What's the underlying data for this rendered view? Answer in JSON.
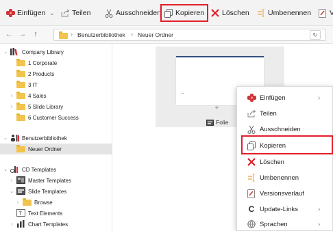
{
  "toolbar": {
    "paste_label": "Einfügen",
    "share_label": "Teilen",
    "cut_label": "Ausschneiden",
    "copy_label": "Kopieren",
    "delete_label": "Löschen",
    "rename_label": "Umbenennen",
    "versions_label": "Ve",
    "highlight_color": "#e31c2b"
  },
  "breadcrumb": {
    "items": [
      "Benutzerbibliothek",
      "Neuer Ordner"
    ]
  },
  "sidebar": {
    "items": [
      {
        "label": "Company Library",
        "icon": "library-icon"
      },
      {
        "label": "1 Corporate",
        "icon": "folder-icon"
      },
      {
        "label": "2 Products",
        "icon": "folder-icon"
      },
      {
        "label": "3 IT",
        "icon": "folder-icon"
      },
      {
        "label": "4 Sales",
        "icon": "folder-icon"
      },
      {
        "label": "5 Slide Library",
        "icon": "folder-icon"
      },
      {
        "label": "6 Customer Success",
        "icon": "folder-icon"
      },
      {
        "label": "Benutzerbibliothek",
        "icon": "user-library-icon"
      },
      {
        "label": "Neuer Ordner",
        "icon": "folder-icon",
        "selected": true
      },
      {
        "label": "CD Templates",
        "icon": "templates-icon"
      },
      {
        "label": "Master Templates",
        "icon": "master-template-icon"
      },
      {
        "label": "Slide Templates",
        "icon": "slide-template-icon"
      },
      {
        "label": "Browse",
        "icon": "folder-icon"
      },
      {
        "label": "Text Elements",
        "icon": "text-element-icon"
      },
      {
        "label": "Chart Templates",
        "icon": "chart-icon"
      }
    ]
  },
  "content": {
    "tile_caption": "Folie"
  },
  "context_menu": {
    "items": [
      {
        "label": "Einfügen",
        "icon": "paste-icon",
        "submenu": true
      },
      {
        "label": "Teilen",
        "icon": "share-icon"
      },
      {
        "label": "Ausschneiden",
        "icon": "cut-icon"
      },
      {
        "label": "Kopieren",
        "icon": "copy-icon",
        "highlighted": true
      },
      {
        "label": "Löschen",
        "icon": "delete-icon"
      },
      {
        "label": "Umbenennen",
        "icon": "rename-icon"
      },
      {
        "label": "Versionsverlauf",
        "icon": "version-history-icon"
      },
      {
        "label": "Update-Links",
        "icon": "update-links-icon",
        "submenu": true
      },
      {
        "label": "Sprachen",
        "icon": "languages-icon",
        "submenu": true
      }
    ]
  }
}
